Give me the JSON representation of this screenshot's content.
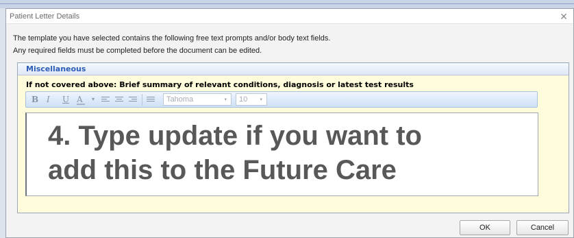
{
  "dialog": {
    "title": "Patient Letter Details",
    "close_glyph": "✕",
    "instructions": [
      "The template you have selected contains the following free text prompts and/or body text fields.",
      "Any required fields must be completed before the document can be edited."
    ]
  },
  "section": {
    "title": "Miscellaneous",
    "prompt": "If not covered above: Brief summary of relevant conditions, diagnosis or latest test results"
  },
  "toolbar": {
    "bold": "B",
    "italic": "I",
    "underline": "U",
    "font_color": "A",
    "dropdown_caret": "▾",
    "font_value": "Tahoma",
    "size_value": "10"
  },
  "editor": {
    "overlay_lines": [
      "4. Type update if you want to",
      "add this to the Future Care"
    ]
  },
  "buttons": {
    "ok": "OK",
    "cancel": "Cancel"
  },
  "colors": {
    "section_background": "#fefcdb",
    "section_title": "#2d5db5",
    "overlay_text": "#585858"
  }
}
